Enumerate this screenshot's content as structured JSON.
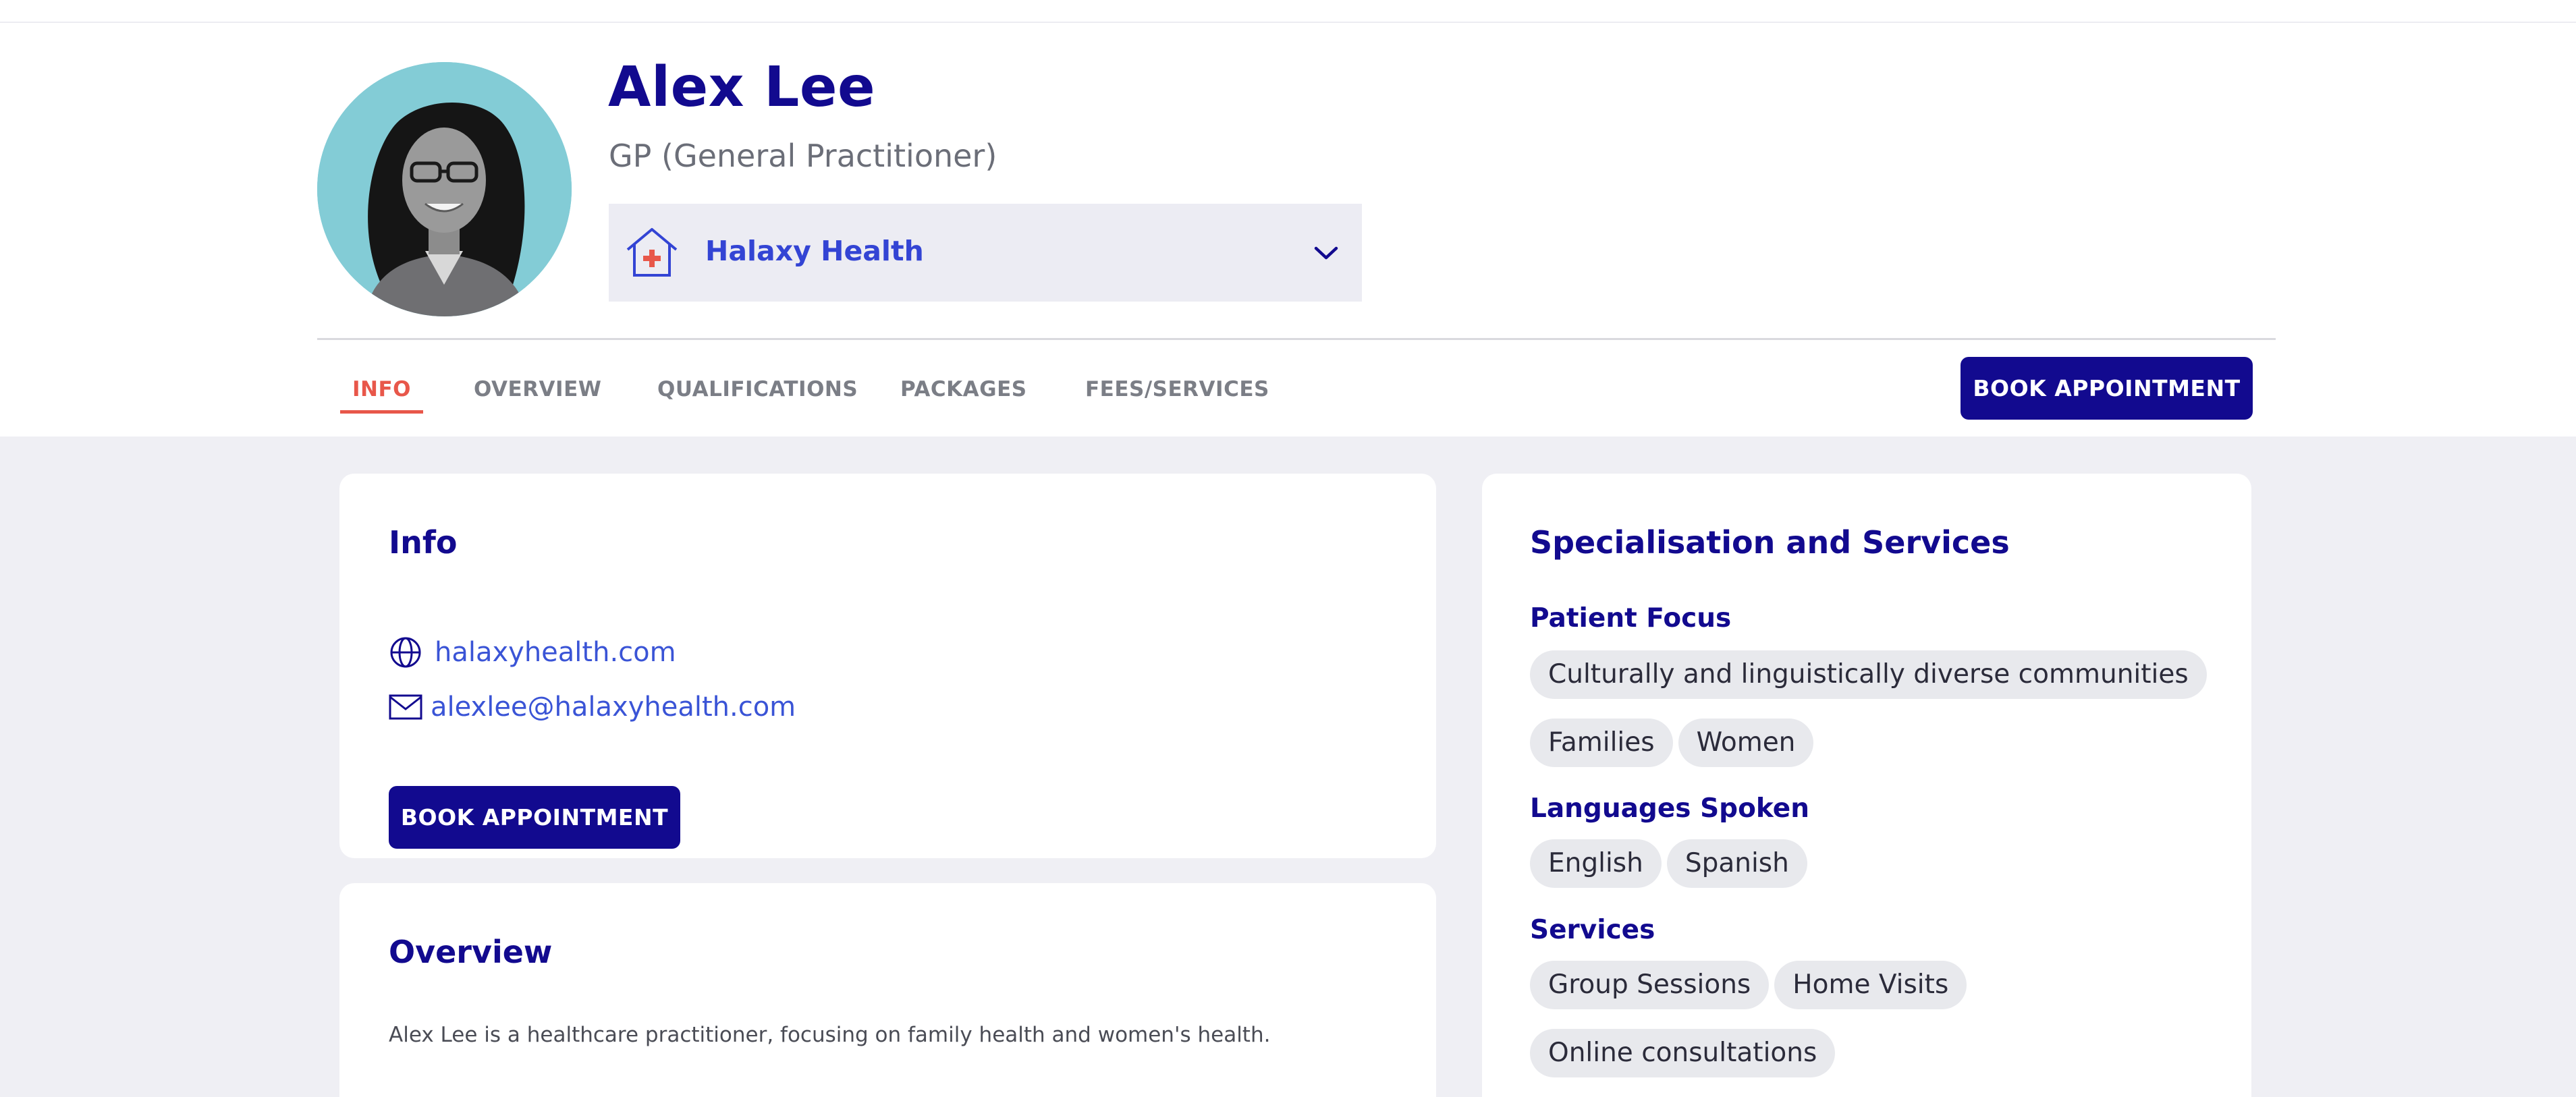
{
  "practitioner": {
    "name": "Alex Lee",
    "role": "GP (General Practitioner)"
  },
  "clinic_select": {
    "icon": "clinic-house-icon",
    "value": "Halaxy Health"
  },
  "tabs": [
    {
      "label": "INFO",
      "active": true
    },
    {
      "label": "OVERVIEW",
      "active": false
    },
    {
      "label": "QUALIFICATIONS",
      "active": false
    },
    {
      "label": "PACKAGES",
      "active": false
    },
    {
      "label": "FEES/SERVICES",
      "active": false
    }
  ],
  "header_book_label": "BOOK APPOINTMENT",
  "info_card": {
    "title": "Info",
    "website": "halaxyhealth.com",
    "email": "alexlee@halaxyhealth.com",
    "book_label": "BOOK APPOINTMENT"
  },
  "overview_card": {
    "title": "Overview",
    "text": "Alex Lee is a healthcare practitioner, focusing on family health and women's health."
  },
  "specialisation_card": {
    "title": "Specialisation and Services",
    "patient_focus": {
      "label": "Patient Focus",
      "items": [
        "Culturally and linguistically diverse communities",
        "Families",
        "Women"
      ]
    },
    "languages": {
      "label": "Languages Spoken",
      "items": [
        "English",
        "Spanish"
      ]
    },
    "services": {
      "label": "Services",
      "items": [
        "Group Sessions",
        "Home Visits",
        "Online consultations"
      ]
    }
  },
  "colors": {
    "brand_navy": "#120a8f",
    "link_blue": "#3a54d6",
    "active_tab": "#e8574a",
    "page_bg": "#efeff4",
    "avatar_bg": "#83ccd6"
  }
}
